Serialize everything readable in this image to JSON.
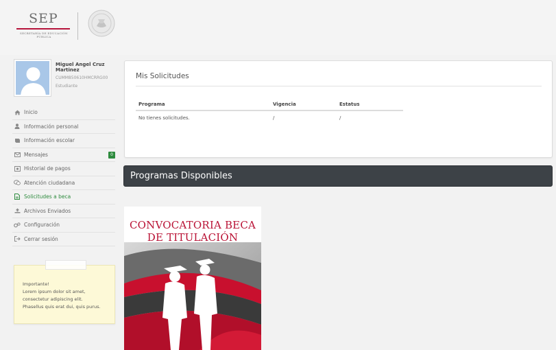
{
  "header": {
    "logo_text": "SEP",
    "logo_subtext": "SECRETARÍA DE EDUCACIÓN PÚBLICA"
  },
  "profile": {
    "name": "Miguel Angel Cruz Martinez",
    "id": "CUMM850610HMCRRG00",
    "role": "Estudiante"
  },
  "sidebar": {
    "items": [
      {
        "label": "Inicio",
        "icon": "home-icon",
        "active": false
      },
      {
        "label": "Información personal",
        "icon": "user-icon",
        "active": false
      },
      {
        "label": "Información escolar",
        "icon": "book-icon",
        "active": false
      },
      {
        "label": "Mensajes",
        "icon": "envelope-icon",
        "active": false,
        "badge": "0"
      },
      {
        "label": "Historial de pagos",
        "icon": "history-icon",
        "active": false
      },
      {
        "label": "Atención ciudadana",
        "icon": "chat-icon",
        "active": false
      },
      {
        "label": "Solicitudes a beca",
        "icon": "document-icon",
        "active": true
      },
      {
        "label": "Archivos Enviados",
        "icon": "upload-icon",
        "active": false
      },
      {
        "label": "Configuración",
        "icon": "gears-icon",
        "active": false
      },
      {
        "label": "Cerrar sesión",
        "icon": "logout-icon",
        "active": false
      }
    ]
  },
  "note": {
    "lines": [
      "Importante!",
      "Lorem ipsum dolor sit amet,",
      "consectetur adipiscing elit.",
      "Phasellus quis erat dui, quis purus."
    ]
  },
  "solicitudes": {
    "title": "Mis Solicitudes",
    "columns": [
      "Programa",
      "Vigencia",
      "Estatus"
    ],
    "rows": [
      [
        "No tienes solicitudes.",
        "/",
        "/"
      ]
    ]
  },
  "programas": {
    "title": "Programas Disponibles",
    "poster_title_line1": "CONVOCATORIA BECA",
    "poster_title_line2": "DE TITULACIÓN"
  },
  "colors": {
    "accent_green": "#2e8b3e",
    "sep_red": "#b5123a",
    "dark_bar": "#3d4247"
  }
}
